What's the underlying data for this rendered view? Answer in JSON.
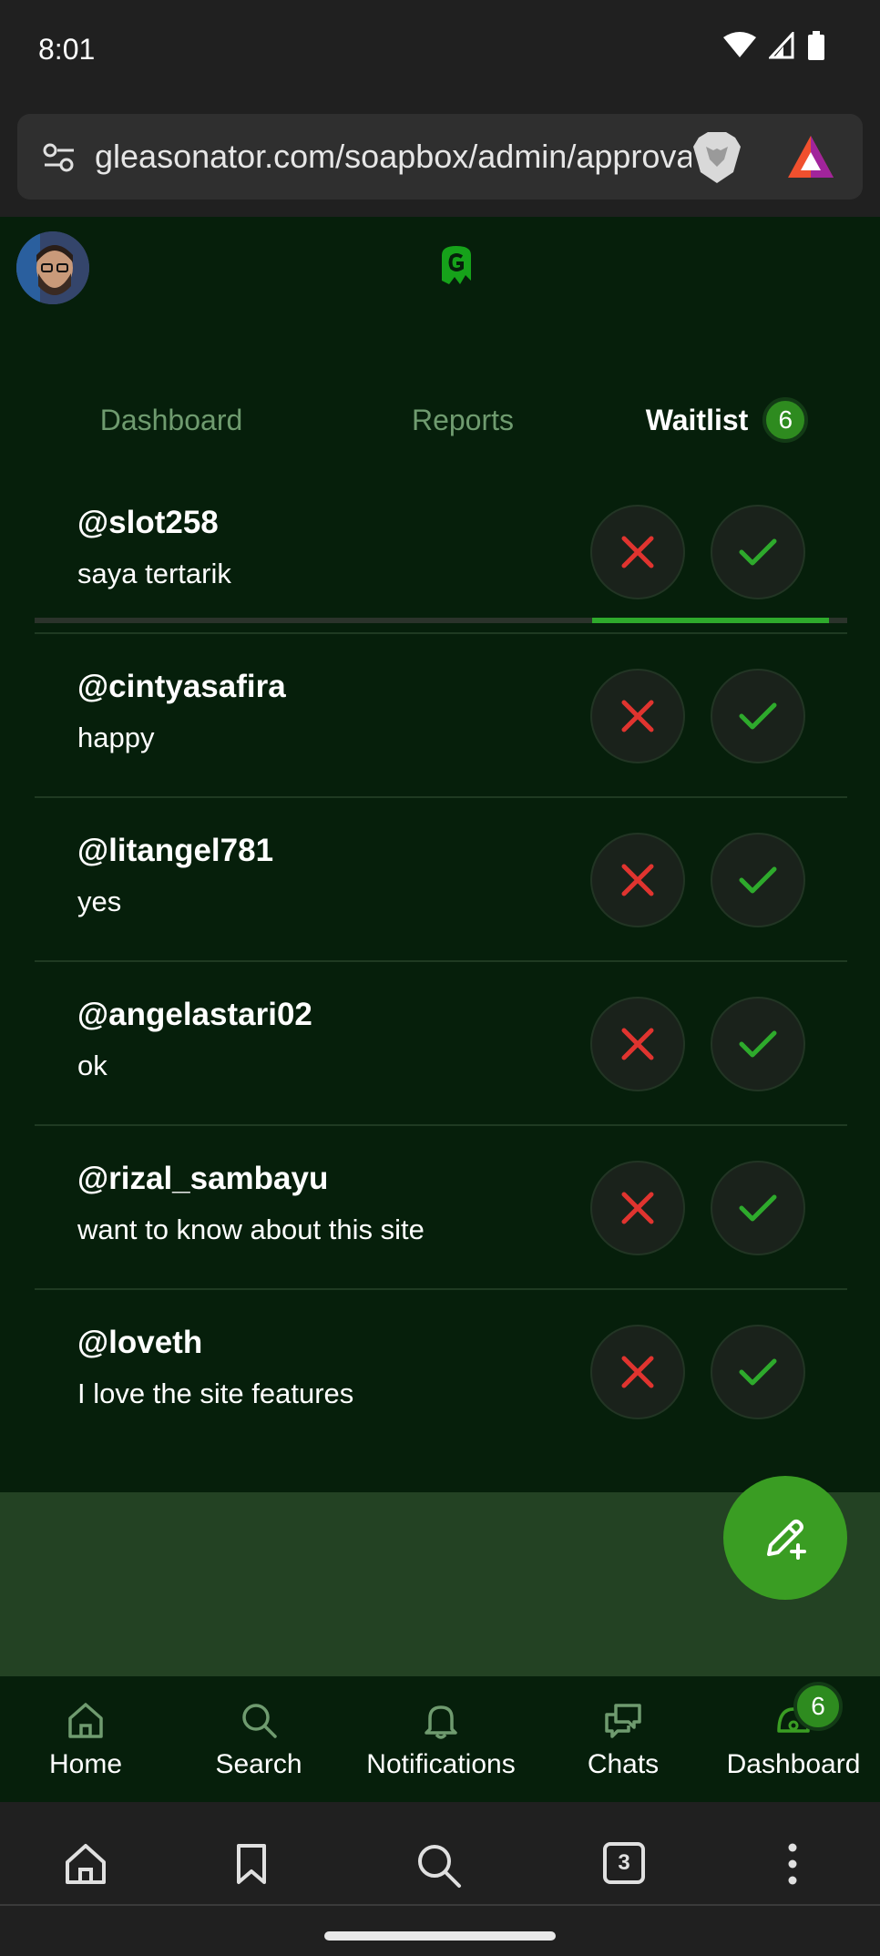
{
  "status_bar": {
    "time": "8:01"
  },
  "browser": {
    "url": "gleasonator.com/soapbox/admin/approval",
    "tab_count": "3"
  },
  "tabs": [
    {
      "label": "Dashboard"
    },
    {
      "label": "Reports"
    },
    {
      "label": "Waitlist",
      "badge": "6"
    }
  ],
  "waitlist": [
    {
      "username": "@slot258",
      "reason": "saya tertarik"
    },
    {
      "username": "@cintyasafira",
      "reason": "happy"
    },
    {
      "username": "@litangel781",
      "reason": "yes"
    },
    {
      "username": "@angelastari02",
      "reason": "ok"
    },
    {
      "username": "@rizal_sambayu",
      "reason": "want to know about this site"
    },
    {
      "username": "@loveth",
      "reason": "I love the site features"
    }
  ],
  "bottom_nav": [
    {
      "label": "Home",
      "icon": "home-icon"
    },
    {
      "label": "Search",
      "icon": "search-icon"
    },
    {
      "label": "Notifications",
      "icon": "bell-icon"
    },
    {
      "label": "Chats",
      "icon": "chats-icon"
    },
    {
      "label": "Dashboard",
      "icon": "dashboard-icon",
      "badge": "6"
    }
  ],
  "colors": {
    "app_background": "#061f0b",
    "accent": "#3a9d23",
    "reject": "#e0342f",
    "approve": "#2eaa2c"
  }
}
